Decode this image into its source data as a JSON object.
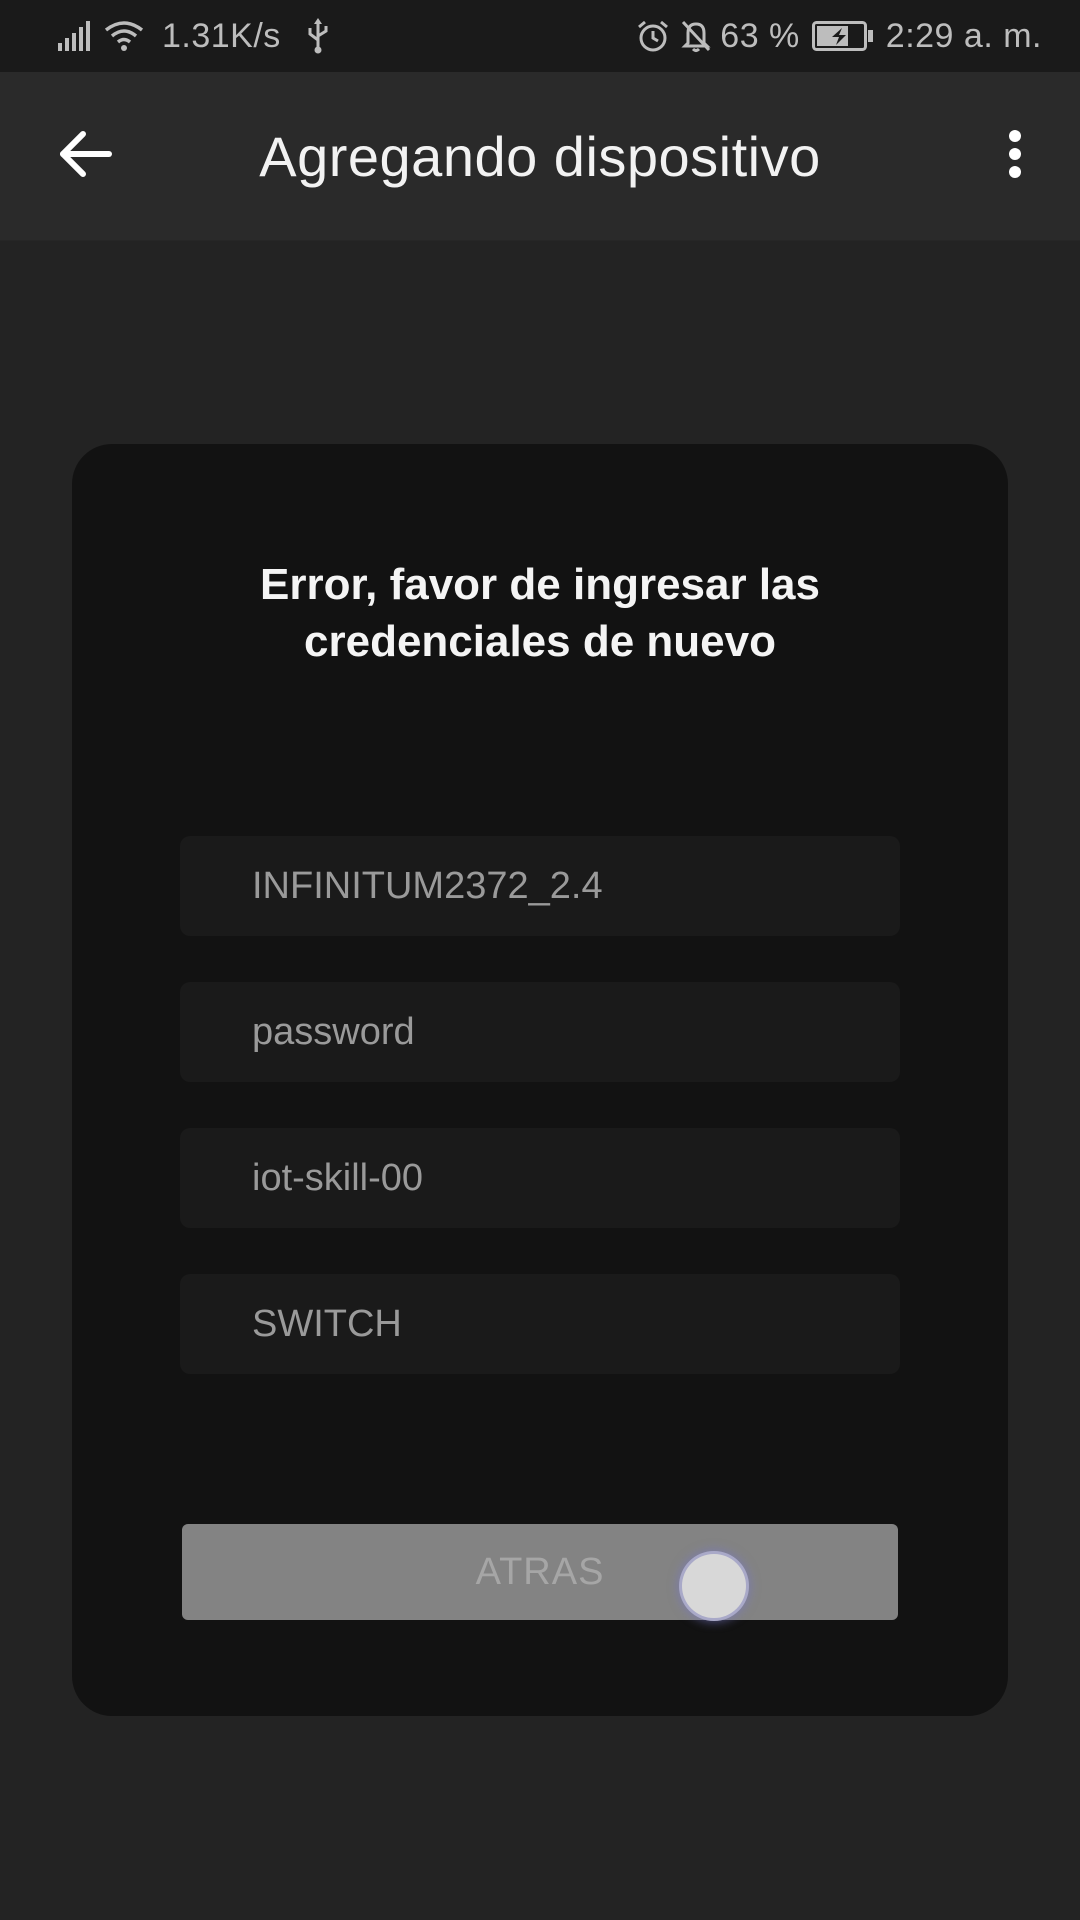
{
  "status_bar": {
    "net_speed": "1.31K/s",
    "battery": "63 %",
    "time": "2:29 a. m.",
    "icons": [
      "signal-icon",
      "wifi-icon",
      "usb-icon",
      "alarm-icon",
      "bell-off-icon",
      "battery-charging-icon"
    ]
  },
  "app_bar": {
    "title": "Agregando dispositivo",
    "back_icon": "arrow-left-icon",
    "menu_icon": "more-vert-icon"
  },
  "card": {
    "heading": "Error, favor de ingresar las credenciales de nuevo",
    "fields": [
      {
        "value": "INFINITUM2372_2.4"
      },
      {
        "placeholder": "password"
      },
      {
        "value": "iot-skill-00"
      },
      {
        "value": "SWITCH"
      }
    ],
    "button_label": "ATRAS"
  },
  "colors": {
    "background": "#232323",
    "app_bar": "#2a2a2a",
    "card": "#121212",
    "field": "#1a1a1a",
    "button": "#838383"
  }
}
